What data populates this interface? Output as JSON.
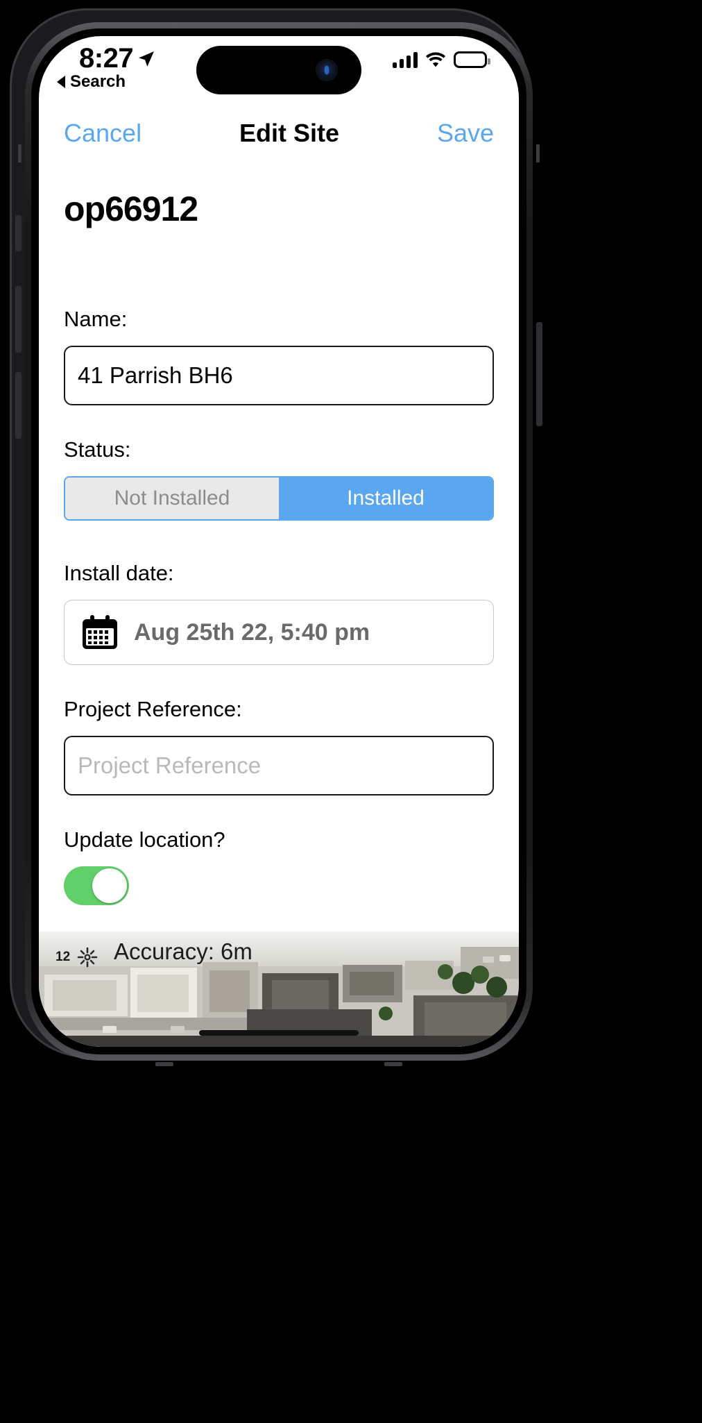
{
  "status_bar": {
    "time": "8:27",
    "location_icon": "location-arrow-icon",
    "signal_icon": "cellular-signal-icon",
    "wifi_icon": "wifi-icon",
    "battery_icon": "battery-full-icon"
  },
  "back": {
    "label": "Search",
    "icon": "back-caret-icon"
  },
  "navbar": {
    "cancel_label": "Cancel",
    "title": "Edit Site",
    "save_label": "Save"
  },
  "form": {
    "site_code": "op66912",
    "name": {
      "label": "Name:",
      "value": "41 Parrish BH6"
    },
    "status": {
      "label": "Status:",
      "options": [
        "Not Installed",
        "Installed"
      ],
      "selected": "Installed"
    },
    "install_date": {
      "label": "Install date:",
      "value": "Aug 25th 22, 5:40 pm",
      "icon": "calendar-icon"
    },
    "project_reference": {
      "label": "Project Reference:",
      "value": "",
      "placeholder": "Project Reference"
    },
    "update_location": {
      "label": "Update location?",
      "toggle_state": "on"
    }
  },
  "map": {
    "zoom_level": "12",
    "compass_icon": "compass-icon",
    "accuracy_text": "Accuracy: 6m"
  },
  "colors": {
    "accent_blue": "#5aa7f0",
    "toggle_green": "#62d06a",
    "segment_inactive_bg": "#e9e9e9",
    "segment_inactive_text": "#8c8c8c",
    "placeholder_text": "#b9b9b9",
    "date_text": "#6a6a6a"
  }
}
